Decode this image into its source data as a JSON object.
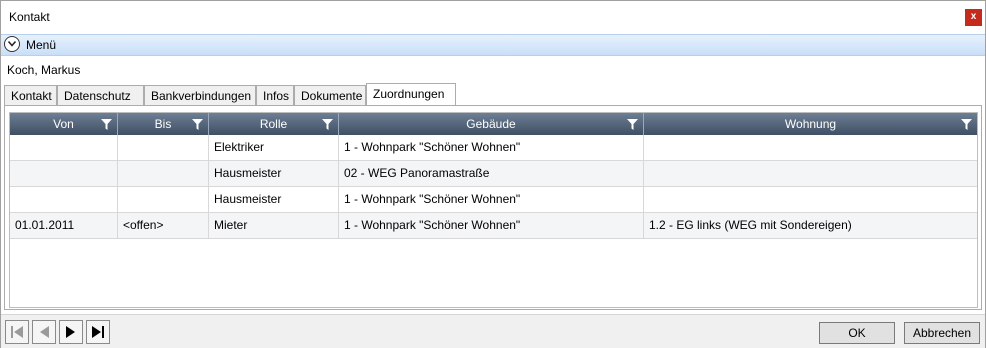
{
  "window": {
    "title": "Kontakt",
    "close_label": "x"
  },
  "menu": {
    "label": "Menü"
  },
  "contact": {
    "name": "Koch, Markus"
  },
  "tabs": [
    {
      "label": "Kontakt"
    },
    {
      "label": "Datenschutz"
    },
    {
      "label": "Bankverbindungen"
    },
    {
      "label": "Infos"
    },
    {
      "label": "Dokumente"
    },
    {
      "label": "Zuordnungen",
      "active": true
    }
  ],
  "grid": {
    "columns": [
      "Von",
      "Bis",
      "Rolle",
      "Gebäude",
      "Wohnung"
    ],
    "rows": [
      [
        "",
        "",
        "Elektriker",
        "1 - Wohnpark \"Schöner Wohnen\"",
        ""
      ],
      [
        "",
        "",
        "Hausmeister",
        "02 - WEG Panoramastraße",
        ""
      ],
      [
        "",
        "",
        "Hausmeister",
        "1 - Wohnpark \"Schöner Wohnen\"",
        ""
      ],
      [
        "01.01.2011",
        "<offen>",
        "Mieter",
        "1 - Wohnpark \"Schöner Wohnen\"",
        "1.2 - EG links (WEG mit Sondereigen)"
      ]
    ]
  },
  "footer": {
    "nav_icons": [
      "first-record-icon",
      "previous-record-icon",
      "next-record-icon",
      "last-record-icon"
    ],
    "ok_label": "OK",
    "cancel_label": "Abbrechen"
  },
  "colors": {
    "header_bg": "#4f5f74",
    "close_bg": "#c42b1c",
    "menu_bg": "#d6e7fb"
  }
}
